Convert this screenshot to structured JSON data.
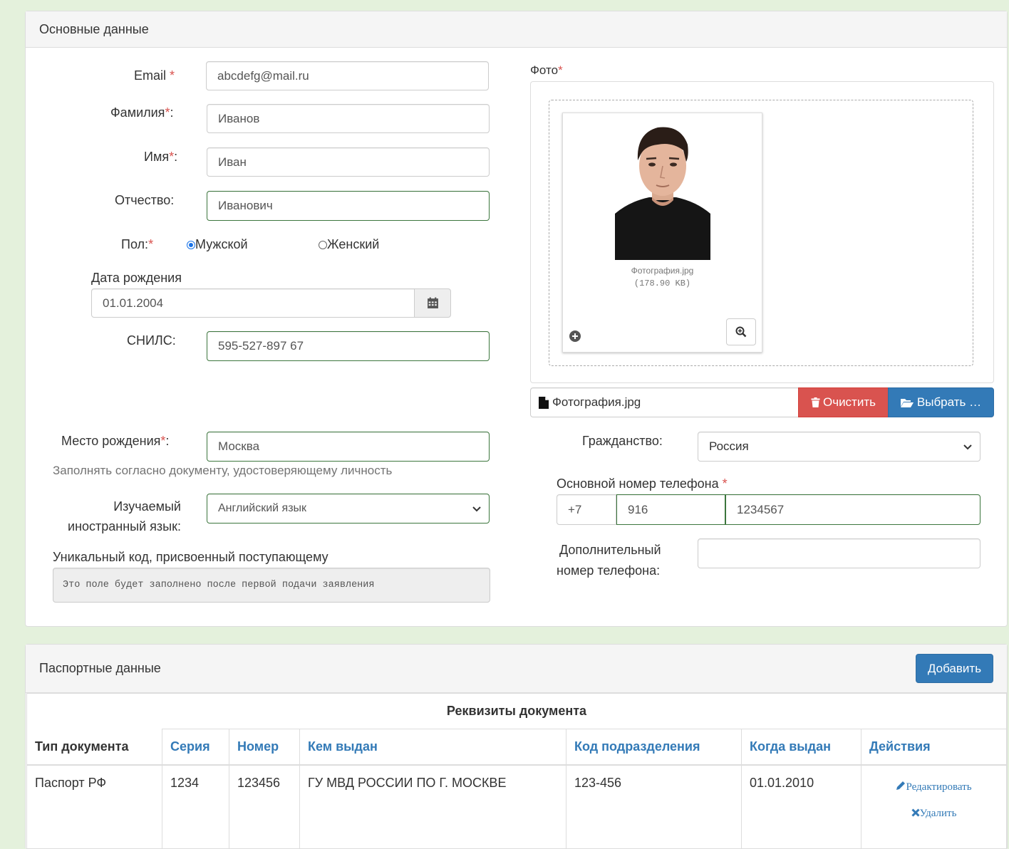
{
  "main_panel": {
    "title": "Основные данные",
    "email": {
      "label": "Email",
      "value": "abcdefg@mail.ru"
    },
    "last_name": {
      "label": "Фамилия",
      "value": "Иванов"
    },
    "first_name": {
      "label": "Имя",
      "value": "Иван"
    },
    "patronymic": {
      "label": "Отчество:",
      "value": "Иванович"
    },
    "gender": {
      "label": "Пол:",
      "male": "Мужской",
      "female": "Женский",
      "selected": "male"
    },
    "birth_date": {
      "label": "Дата рождения",
      "value": "01.01.2004"
    },
    "snils": {
      "label": "СНИЛС:",
      "value": "595-527-897 67"
    },
    "birth_place": {
      "label": "Место рождения",
      "value": "Москва",
      "hint": "Заполнять согласно документу, удостоверяющему личность"
    },
    "language": {
      "label_line1": "Изучаемый",
      "label_line2": "иностранный язык:",
      "value": "Английский язык"
    },
    "unique_code": {
      "label": "Уникальный код, присвоенный поступающему",
      "value": "Это поле будет заполнено после первой подачи заявления"
    },
    "photo": {
      "label": "Фото",
      "file_name": "Фотография.jpg",
      "file_size": "(178.90 KB)",
      "input_file": "Фотография.jpg",
      "clear_label": "Очистить",
      "choose_label": "Выбрать …"
    },
    "citizenship": {
      "label": "Гражданство:",
      "value": "Россия"
    },
    "phone": {
      "label": "Основной номер телефона",
      "country": "+7",
      "code": "916",
      "number": "1234567"
    },
    "extra_phone": {
      "label_line1": "Дополнительный",
      "label_line2": "номер телефона:",
      "value": ""
    }
  },
  "passport_panel": {
    "title": "Паспортные данные",
    "add_label": "Добавить",
    "group_header": "Реквизиты документа",
    "columns": [
      "Тип документа",
      "Серия",
      "Номер",
      "Кем выдан",
      "Код подразделения",
      "Когда выдан",
      "Действия"
    ],
    "rows": [
      [
        "Паспорт РФ",
        "1234",
        "123456",
        "ГУ МВД РОССИИ ПО Г. МОСКВЕ",
        "123-456",
        "01.01.2010"
      ]
    ],
    "edit_label": "Редактировать",
    "delete_label": "Удалить"
  },
  "colors": {
    "success_border": "#3c763d",
    "danger": "#d9534f",
    "primary": "#337ab7",
    "page_background": "#e4f1dc"
  }
}
